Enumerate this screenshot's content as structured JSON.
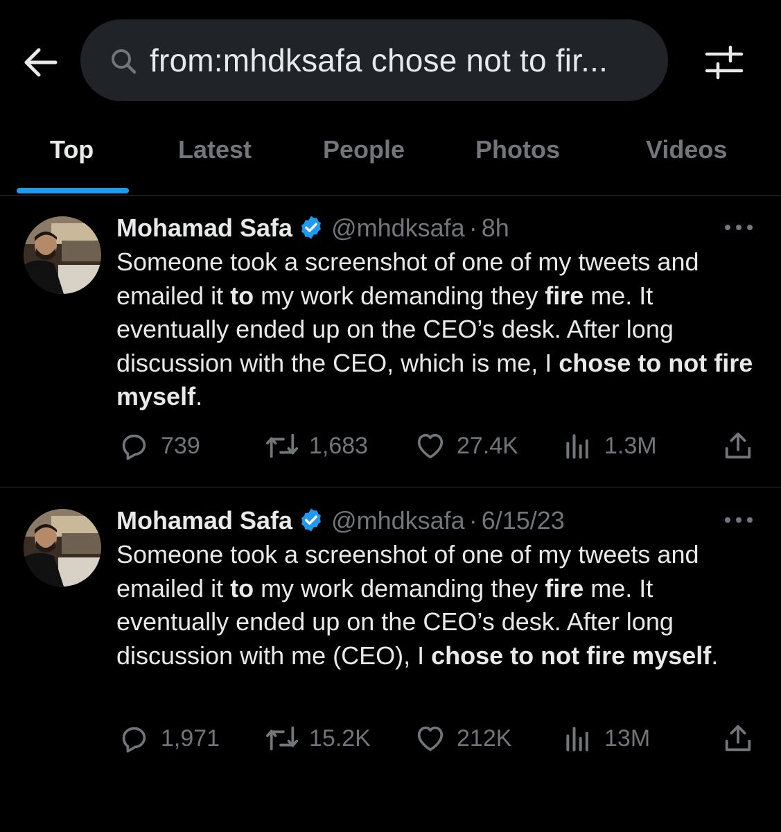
{
  "header": {
    "search_query": "from:mhdksafa chose not to fir..."
  },
  "tabs": [
    {
      "label": "Top"
    },
    {
      "label": "Latest"
    },
    {
      "label": "People"
    },
    {
      "label": "Photos"
    },
    {
      "label": "Videos"
    }
  ],
  "tweets": [
    {
      "name": "Mohamad Safa",
      "handle": "@mhdksafa",
      "separator": "·",
      "time": "8h",
      "body": [
        {
          "text": "Someone took a screenshot of one of my tweets and emailed it ",
          "bold": false
        },
        {
          "text": "to",
          "bold": true
        },
        {
          "text": " my work demanding they ",
          "bold": false
        },
        {
          "text": "fire",
          "bold": true
        },
        {
          "text": " me. It eventually ended up on the CEO’s desk. After long discussion with the CEO, which is me, I ",
          "bold": false
        },
        {
          "text": "chose to not fire myself",
          "bold": true
        },
        {
          "text": ".",
          "bold": false
        }
      ],
      "stats": {
        "replies": "739",
        "retweets": "1,683",
        "likes": "27.4K",
        "views": "1.3M"
      }
    },
    {
      "name": "Mohamad Safa",
      "handle": "@mhdksafa",
      "separator": "·",
      "time": "6/15/23",
      "body": [
        {
          "text": "Someone took a screenshot of one of my tweets and emailed it ",
          "bold": false
        },
        {
          "text": "to",
          "bold": true
        },
        {
          "text": " my work demanding they ",
          "bold": false
        },
        {
          "text": "fire",
          "bold": true
        },
        {
          "text": " me. It eventually ended up on the CEO’s desk. After long discussion with me (CEO), I ",
          "bold": false
        },
        {
          "text": "chose to not fire myself",
          "bold": true
        },
        {
          "text": ".",
          "bold": false
        }
      ],
      "stats": {
        "replies": "1,971",
        "retweets": "15.2K",
        "likes": "212K",
        "views": "13M"
      }
    }
  ],
  "icons": {
    "back": "arrow-left-icon",
    "search": "search-icon",
    "filter": "sliders-icon",
    "verified": "verified-badge-icon",
    "more": "more-horizontal-icon",
    "reply": "reply-icon",
    "retweet": "retweet-icon",
    "like": "heart-icon",
    "views": "bar-chart-icon",
    "share": "share-icon"
  },
  "colors": {
    "background": "#000000",
    "search_bg": "#202327",
    "text_primary": "#e7e9ea",
    "text_secondary": "#71767b",
    "accent": "#1d9bf0",
    "divider": "#2f3336"
  }
}
